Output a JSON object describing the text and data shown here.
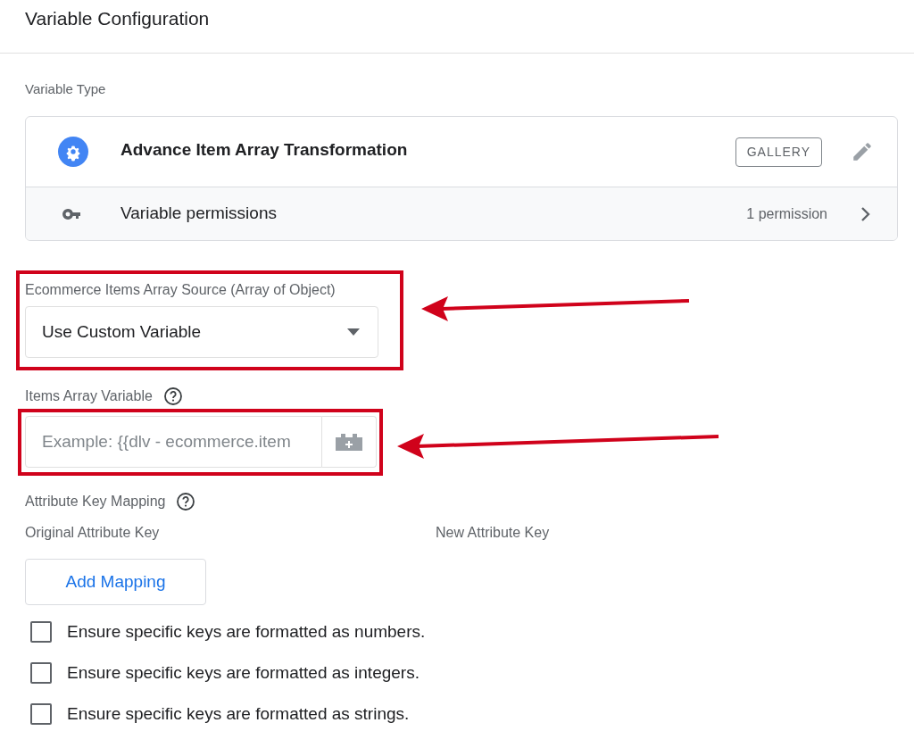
{
  "title": "Variable Configuration",
  "variable_type": {
    "label": "Variable Type",
    "name": "Advance Item Array Transformation",
    "gallery_button": "GALLERY",
    "permissions_label": "Variable permissions",
    "permissions_count": "1 permission"
  },
  "source_field": {
    "label": "Ecommerce Items Array Source (Array of Object)",
    "value": "Use Custom Variable",
    "highlighted": true
  },
  "items_field": {
    "label": "Items Array Variable",
    "placeholder": "Example: {{dlv - ecommerce.item",
    "highlighted": true
  },
  "mapping": {
    "label": "Attribute Key Mapping",
    "columns": [
      "Original Attribute Key",
      "New Attribute Key"
    ],
    "add_button": "Add Mapping"
  },
  "options": [
    {
      "label": "Ensure specific keys are formatted as numbers.",
      "checked": false
    },
    {
      "label": "Ensure specific keys are formatted as integers.",
      "checked": false
    },
    {
      "label": "Ensure specific keys are formatted as strings.",
      "checked": false
    }
  ]
}
